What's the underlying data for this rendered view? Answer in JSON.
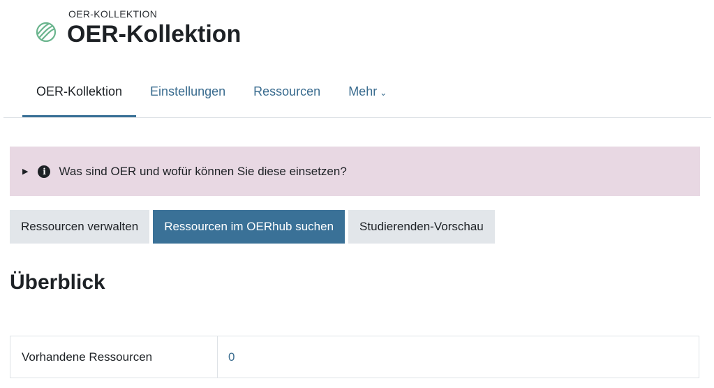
{
  "header": {
    "pre_title": "OER-KOLLEKTION",
    "title": "OER-Kollektion",
    "logo_icon": "oer-globe-icon"
  },
  "nav": {
    "items": [
      {
        "label": "OER-Kollektion",
        "active": true
      },
      {
        "label": "Einstellungen",
        "active": false
      },
      {
        "label": "Ressourcen",
        "active": false
      },
      {
        "label": "Mehr",
        "active": false
      }
    ]
  },
  "info": {
    "text": "Was sind OER und wofür können Sie diese einsetzen?",
    "icon": "info-icon",
    "background": "#e8d8e3"
  },
  "buttons": {
    "manage": "Ressourcen verwalten",
    "search": "Ressourcen im OERhub suchen",
    "preview": "Studierenden-Vorschau"
  },
  "overview": {
    "heading": "Überblick",
    "rows": [
      {
        "label": "Vorhandene Ressourcen",
        "value": "0"
      }
    ]
  },
  "colors": {
    "primary": "#3a7197",
    "link": "#3a6c8f",
    "logo": "#6bb58e"
  }
}
